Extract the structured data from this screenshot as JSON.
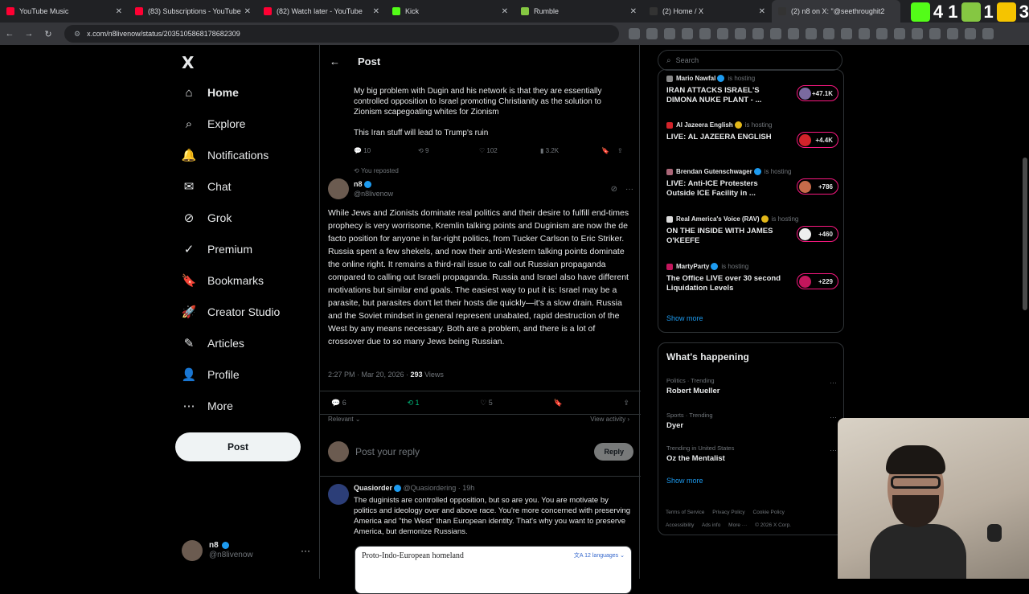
{
  "browser": {
    "tabs": [
      {
        "title": "YouTube Music",
        "color": "#ff0033"
      },
      {
        "title": "(83) Subscriptions - YouTube",
        "color": "#ff0033"
      },
      {
        "title": "(82) Watch later - YouTube",
        "color": "#ff0033"
      },
      {
        "title": "Kick",
        "color": "#53fc18"
      },
      {
        "title": "Rumble",
        "color": "#85c742"
      },
      {
        "title": "(2) Home / X",
        "color": "#e7e9ea"
      },
      {
        "title": "(2) n8 on X: \"@seethroughit2",
        "color": "#e7e9ea"
      }
    ],
    "url": "x.com/n8livenow/status/2035105868178682309",
    "overlay": {
      "kick_count": "4 1",
      "rumble_count": "1",
      "third_count": "3"
    }
  },
  "sidebar": {
    "logo": "X",
    "items": [
      {
        "label": "Home",
        "icon": "home-icon",
        "glyph": "⌂"
      },
      {
        "label": "Explore",
        "icon": "search-icon",
        "glyph": "⌕"
      },
      {
        "label": "Notifications",
        "icon": "bell-icon",
        "glyph": "🔔"
      },
      {
        "label": "Chat",
        "icon": "mail-icon",
        "glyph": "✉"
      },
      {
        "label": "Grok",
        "icon": "grok-icon",
        "glyph": "⊘"
      },
      {
        "label": "Premium",
        "icon": "premium-icon",
        "glyph": "✓"
      },
      {
        "label": "Bookmarks",
        "icon": "bookmark-icon",
        "glyph": "🔖"
      },
      {
        "label": "Creator Studio",
        "icon": "rocket-icon",
        "glyph": "🚀"
      },
      {
        "label": "Articles",
        "icon": "article-icon",
        "glyph": "✎"
      },
      {
        "label": "Profile",
        "icon": "person-icon",
        "glyph": "👤"
      },
      {
        "label": "More",
        "icon": "more-icon",
        "glyph": "⋯"
      }
    ],
    "post_label": "Post",
    "user": {
      "name": "n8",
      "handle": "@n8livenow"
    }
  },
  "main": {
    "title": "Post",
    "prev_tweet": {
      "text1": "My big problem with Dugin and his network is that they are essentially controlled opposition to Israel promoting Christianity as the solution to Zionism scapegoating whites for Zionism",
      "text2": "This Iran stuff will lead to Trump's ruin",
      "replies": "10",
      "reposts": "9",
      "likes": "102",
      "views": "3.2K"
    },
    "repost_note": "You reposted",
    "tweet": {
      "name": "n8",
      "handle": "@n8livenow",
      "text": "While Jews and Zionists dominate real politics and their desire to fulfill end-times prophecy is very worrisome, Kremlin talking points and Duginism are now the de facto position for anyone in far-right politics, from Tucker Carlson to Eric Striker. Russia spent a few shekels, and now their anti-Western talking points dominate the online right. It remains a third-rail issue to call out Russian propaganda compared to calling out Israeli propaganda. Russia and Israel also have different motivations but similar end goals. The easiest way to put it is: Israel may be a parasite, but parasites don't let their hosts die quickly—it's a slow drain. Russia and the Soviet mindset in general represent unabated, rapid destruction of the West by any means necessary. Both are a problem, and there is a lot of crossover due to so many Jews being Russian.",
      "time": "2:27 PM · Mar 20, 2026 · ",
      "views_count": "293",
      "views_label": " Views",
      "replies": "6",
      "reposts": "1",
      "likes": "5"
    },
    "relevant": "Relevant ⌄",
    "view_activity": "View activity ›",
    "reply_placeholder": "Post your reply",
    "reply_button": "Reply",
    "reply": {
      "name": "Quasiorder",
      "handle": "@Quasiordering · 19h",
      "text": "The duginists are controlled opposition, but so are you. You are motivate by politics and ideology over and above race. You're more concerned with preserving America and \"the West\" than European identity. That's why you want to preserve America, but demonize Russians.",
      "embed_title": "Proto-Indo-European homeland",
      "embed_lang": "文A 12 languages ⌄"
    }
  },
  "right": {
    "search_placeholder": "Search",
    "lives": [
      {
        "host": "Mario Nawfal",
        "title": "IRAN ATTACKS ISRAEL'S DIMONA NUKE PLANT - ...",
        "count": "+47.1K"
      },
      {
        "host": "Al Jazeera English",
        "title": "LIVE: AL JAZEERA ENGLISH",
        "count": "+4.4K"
      },
      {
        "host": "Brendan Gutenschwager",
        "title": "LIVE: Anti-ICE Protesters Outside ICE Facility in ...",
        "count": "+786"
      },
      {
        "host": "Real America's Voice (RAV)",
        "title": "ON THE INSIDE WITH JAMES O'KEEFE",
        "count": "+460"
      },
      {
        "host": "MartyParty",
        "title": "The Office LIVE over 30 second Liquidation Levels",
        "count": "+229"
      }
    ],
    "is_hosting": "is hosting",
    "show_more": "Show more",
    "happening_title": "What's happening",
    "trends": [
      {
        "category": "Politics · Trending",
        "name": "Robert Mueller"
      },
      {
        "category": "Sports · Trending",
        "name": "Dyer"
      },
      {
        "category": "Trending in United States",
        "name": "Oz the Mentalist"
      }
    ],
    "footer": [
      "Terms of Service",
      "Privacy Policy",
      "Cookie Policy",
      "Accessibility",
      "Ads info",
      "More ···",
      "© 2026 X Corp."
    ]
  }
}
